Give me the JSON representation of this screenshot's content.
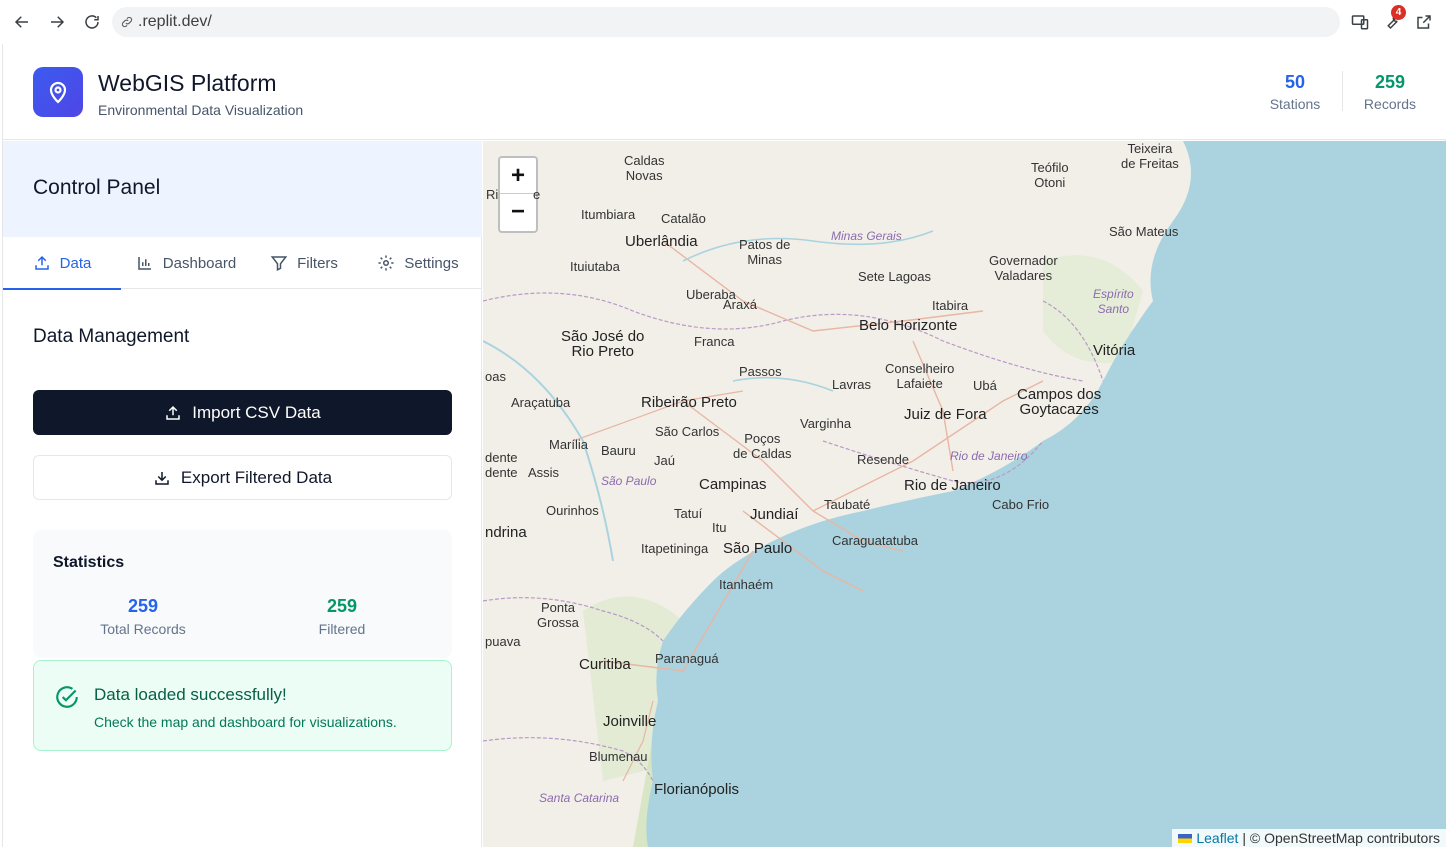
{
  "browser": {
    "url": ".replit.dev/",
    "extension_badge": "4"
  },
  "header": {
    "title": "WebGIS Platform",
    "subtitle": "Environmental Data Visualization",
    "stats": [
      {
        "value": "50",
        "label": "Stations",
        "color": "#2563eb"
      },
      {
        "value": "259",
        "label": "Records",
        "color": "#059669"
      }
    ]
  },
  "sidebar": {
    "title": "Control Panel",
    "tabs": [
      {
        "label": "Data",
        "icon": "upload-icon",
        "active": true
      },
      {
        "label": "Dashboard",
        "icon": "bar-chart-icon"
      },
      {
        "label": "Filters",
        "icon": "filter-icon"
      },
      {
        "label": "Settings",
        "icon": "gear-icon"
      }
    ],
    "section_title": "Data Management",
    "import_label": "Import CSV Data",
    "export_label": "Export Filtered Data",
    "statistics": {
      "title": "Statistics",
      "total_value": "259",
      "total_label": "Total Records",
      "filtered_value": "259",
      "filtered_label": "Filtered"
    },
    "success": {
      "title": "Data loaded successfully!",
      "text": "Check the map and dashboard for visualizations."
    }
  },
  "map": {
    "zoom_in": "+",
    "zoom_out": "−",
    "attribution_leaflet": "Leaflet",
    "attribution_rest": "| © OpenStreetMap contributors",
    "places": [
      {
        "id": "caldas-novas",
        "label": "Caldas\nNovas"
      },
      {
        "id": "teofilo-otoni",
        "label": "Teófilo\nOtoni"
      },
      {
        "id": "teixeira",
        "label": "Teixeira\nde Freitas"
      },
      {
        "id": "itumbiara",
        "label": "Itumbiara"
      },
      {
        "id": "catalao",
        "label": "Catalão"
      },
      {
        "id": "uberlandia",
        "label": "Uberlândia"
      },
      {
        "id": "patos",
        "label": "Patos de\nMinas"
      },
      {
        "id": "minas-gerais",
        "label": "Minas Gerais"
      },
      {
        "id": "sao-mateus",
        "label": "São Mateus"
      },
      {
        "id": "ituiutaba",
        "label": "Ituiutaba"
      },
      {
        "id": "governador",
        "label": "Governador\nValadares"
      },
      {
        "id": "sete-lagoas",
        "label": "Sete Lagoas"
      },
      {
        "id": "espirito-santo",
        "label": "Espírito\nSanto"
      },
      {
        "id": "uberaba",
        "label": "Uberaba"
      },
      {
        "id": "araxa",
        "label": "Araxá"
      },
      {
        "id": "itabira",
        "label": "Itabira"
      },
      {
        "id": "belo-horizonte",
        "label": "Belo Horizonte"
      },
      {
        "id": "sjrp",
        "label": "São José do\nRio Preto"
      },
      {
        "id": "franca",
        "label": "Franca"
      },
      {
        "id": "vitoria",
        "label": "Vitória"
      },
      {
        "id": "passos",
        "label": "Passos"
      },
      {
        "id": "conselheiro",
        "label": "Conselheiro\nLafaiete"
      },
      {
        "id": "lavras",
        "label": "Lavras"
      },
      {
        "id": "uba",
        "label": "Ubá"
      },
      {
        "id": "campos",
        "label": "Campos dos\nGoytacazes"
      },
      {
        "id": "aracatuba",
        "label": "Araçatuba"
      },
      {
        "id": "ribeirao",
        "label": "Ribeirão Preto"
      },
      {
        "id": "juiz-de-fora",
        "label": "Juiz de Fora"
      },
      {
        "id": "sao-carlos",
        "label": "São Carlos"
      },
      {
        "id": "varginha",
        "label": "Varginha"
      },
      {
        "id": "pocos",
        "label": "Poços\nde Caldas"
      },
      {
        "id": "marilia",
        "label": "Marília"
      },
      {
        "id": "bauru",
        "label": "Bauru"
      },
      {
        "id": "jau",
        "label": "Jaú"
      },
      {
        "id": "resende",
        "label": "Resende"
      },
      {
        "id": "rio-state",
        "label": "Rio de Janeiro"
      },
      {
        "id": "assis",
        "label": "Assis"
      },
      {
        "id": "sao-paulo-state",
        "label": "São Paulo"
      },
      {
        "id": "campinas",
        "label": "Campinas"
      },
      {
        "id": "rio",
        "label": "Rio de Janeiro"
      },
      {
        "id": "taubate",
        "label": "Taubaté"
      },
      {
        "id": "cabo-frio",
        "label": "Cabo Frio"
      },
      {
        "id": "ourinhos",
        "label": "Ourinhos"
      },
      {
        "id": "tatui",
        "label": "Tatuí"
      },
      {
        "id": "jundiai",
        "label": "Jundiaí"
      },
      {
        "id": "itu",
        "label": "Itu"
      },
      {
        "id": "caraguatatuba",
        "label": "Caraguatatuba"
      },
      {
        "id": "itapetininga",
        "label": "Itapetininga"
      },
      {
        "id": "sao-paulo",
        "label": "São Paulo"
      },
      {
        "id": "itanhaem",
        "label": "Itanhaém"
      },
      {
        "id": "ponta-grossa",
        "label": "Ponta\nGrossa"
      },
      {
        "id": "curitiba",
        "label": "Curitiba"
      },
      {
        "id": "paranagua",
        "label": "Paranaguá"
      },
      {
        "id": "joinville",
        "label": "Joinville"
      },
      {
        "id": "blumenau",
        "label": "Blumenau"
      },
      {
        "id": "santa-catarina",
        "label": "Santa Catarina"
      },
      {
        "id": "florianopolis",
        "label": "Florianópolis"
      },
      {
        "id": "edge-ri",
        "label": "Ri"
      },
      {
        "id": "edge-e",
        "label": "e"
      },
      {
        "id": "edge-oas",
        "label": "oas"
      },
      {
        "id": "edge-dente1",
        "label": "dente"
      },
      {
        "id": "edge-dente2",
        "label": "dente"
      },
      {
        "id": "edge-ndrina",
        "label": "ndrina"
      },
      {
        "id": "edge-puava",
        "label": "puava"
      }
    ]
  }
}
